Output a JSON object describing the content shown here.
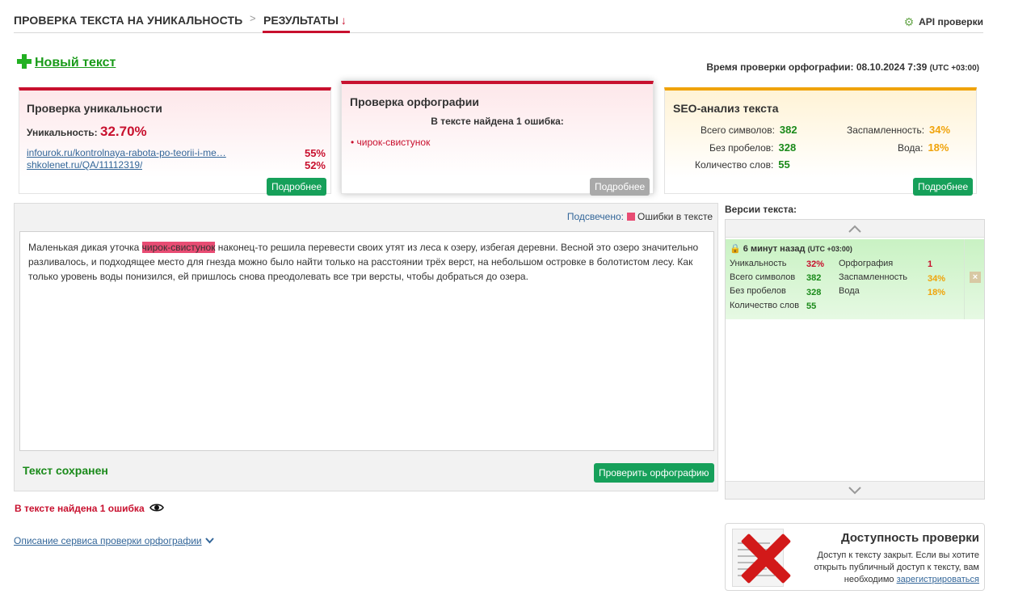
{
  "topnav": {
    "crumb_check": "ПРОВЕРКА ТЕКСТА НА УНИКАЛЬНОСТЬ",
    "separator": ">",
    "crumb_results": "РЕЗУЛЬТАТЫ",
    "results_arrow": "↓",
    "api_label": "API проверки"
  },
  "new_text_label": "Новый текст",
  "check_time": {
    "label": "Время проверки орфографии: 08.10.2024 7:39",
    "tz": "(UTC +03:00)"
  },
  "uniqueness_card": {
    "title": "Проверка уникальности",
    "label": "Уникальность:",
    "value": "32.70%",
    "sources": [
      {
        "url": "infourok.ru/kontrolnaya-rabota-po-teorii-i-me…",
        "pct": "55%"
      },
      {
        "url": "shkolenet.ru/QA/11112319/",
        "pct": "52%"
      }
    ],
    "more_button": "Подробнее"
  },
  "spelling_card": {
    "title": "Проверка орфографии",
    "found": "В тексте найдена 1 ошибка:",
    "errors": [
      "• чирок-свистунок"
    ],
    "more_button": "Подробнее"
  },
  "seo_card": {
    "title": "SEO-анализ текста",
    "total_chars_label": "Всего символов:",
    "total_chars": "382",
    "no_spaces_label": "Без пробелов:",
    "no_spaces": "328",
    "words_label": "Количество слов:",
    "words": "55",
    "spam_label": "Заспамленность:",
    "spam": "34%",
    "water_label": "Вода:",
    "water": "18%",
    "more_button": "Подробнее"
  },
  "editor": {
    "legend_highlighted": "Подсвечено:",
    "legend_errors": "Ошибки в тексте",
    "text_before": "Маленькая дикая уточка ",
    "text_marked": "чирок-свистунок",
    "text_after": " наконец-то решила перевести своих утят из леса к озеру, избегая деревни. Весной это озеро значительно разливалось, и подходящее место для гнезда можно было найти только на расстоянии трёх верст, на небольшом островке в болотистом лесу. Как только уровень воды понизился, ей пришлось снова преодолевать все три версты, чтобы добраться до озера.",
    "saved_label": "Текст сохранен",
    "check_spelling_button": "Проверить орфографию"
  },
  "bottom_error": "В тексте найдена 1 ошибка",
  "description_link": "Описание сервиса проверки орфографии",
  "versions": {
    "title": "Версии текста:",
    "item": {
      "time": "6 минут назад",
      "tz": "(UTC +03:00)",
      "uniq_label": "Уникальность",
      "uniq": "32%",
      "spell_label": "Орфография",
      "spell": "1",
      "chars_label": "Всего символов",
      "chars": "382",
      "spam_label": "Заспамленность",
      "spam": "34%",
      "nospace_label": "Без пробелов",
      "nospace": "328",
      "water_label": "Вода",
      "water": "18%",
      "words_label": "Количество слов",
      "words": "55"
    }
  },
  "access": {
    "title": "Доступность проверки",
    "text1": "Доступ к тексту закрыт. Если вы хотите открыть публичный доступ к тексту, вам необходимо ",
    "register": "зарегистрироваться"
  },
  "colors": {
    "accent_red": "#c8102e",
    "accent_green": "#16a05a",
    "accent_orange": "#f0a30a",
    "highlight": "#e84c73"
  }
}
